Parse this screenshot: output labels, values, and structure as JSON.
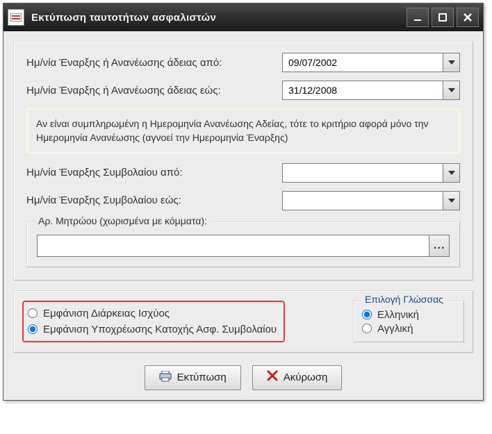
{
  "window": {
    "title": "Εκτύπωση ταυτοτήτων ασφαλιστών"
  },
  "form": {
    "license_from_label": "Ημ/νία Έναρξης ή Ανανέωσης άδειας από:",
    "license_from_value": "09/07/2002",
    "license_to_label": "Ημ/νία Έναρξης ή Ανανέωσης άδειας εώς:",
    "license_to_value": "31/12/2008",
    "note_text": "Αν είναι συμπληρωμένη η Ημερομηνία Ανανέωσης Αδείας, τότε το κριτήριο αφορά μόνο την Ημερομηνία Ανανέωσης (αγνοεί την Ημερομηνία Έναρξης)",
    "contract_from_label": "Ημ/νία Έναρξης Συμβολαίου από:",
    "contract_from_value": "",
    "contract_to_label": "Ημ/νία Έναρξης Συμβολαίου εώς:",
    "contract_to_value": "",
    "registry_legend": "Αρ. Μητρώου (χωρισμένα με κόμματα):",
    "registry_value": ""
  },
  "display": {
    "option1_label": "Εμφάνιση Διάρκειας Ισχύος",
    "option2_label": "Εμφάνιση Υποχρέωσης Κατοχής Ασφ. Συμβολαίου",
    "selected": "option2"
  },
  "language": {
    "legend": "Επιλογή Γλώσσας",
    "greek_label": "Ελληνική",
    "english_label": "Αγγλική",
    "selected": "greek"
  },
  "buttons": {
    "print_label": "Εκτύπωση",
    "cancel_label": "Ακύρωση"
  }
}
